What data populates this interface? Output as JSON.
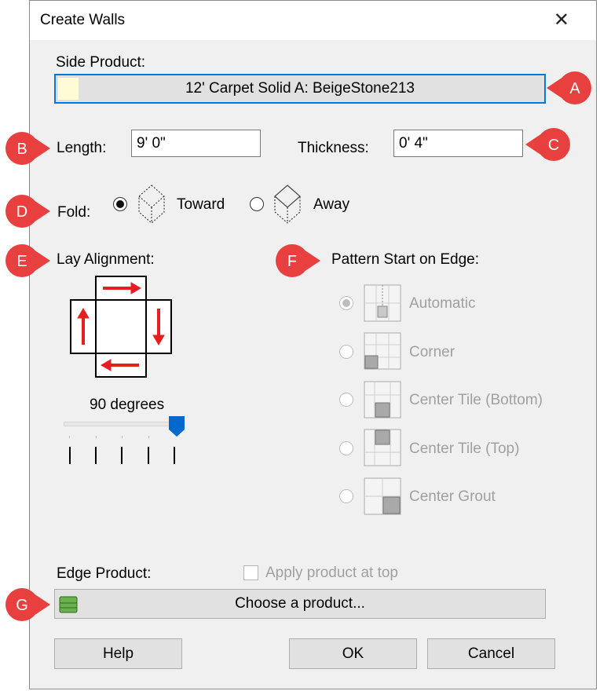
{
  "dialog": {
    "title": "Create Walls",
    "close_glyph": "✕"
  },
  "side_product": {
    "label": "Side Product:",
    "value": "12' Carpet Solid A: BeigeStone213",
    "swatch_color": "#fffbd5"
  },
  "length": {
    "label": "Length:",
    "value": "9' 0\""
  },
  "thickness": {
    "label": "Thickness:",
    "value": "0' 4\""
  },
  "fold": {
    "label": "Fold:",
    "options": [
      {
        "label": "Toward",
        "selected": true,
        "icon": "fold-toward-icon"
      },
      {
        "label": "Away",
        "selected": false,
        "icon": "fold-away-icon"
      }
    ]
  },
  "lay_alignment": {
    "label": "Lay Alignment:",
    "degrees_text": "90 degrees",
    "slider_position_fraction": 1.0,
    "tick_count": 5
  },
  "pattern_start": {
    "label": "Pattern Start on Edge:",
    "disabled": true,
    "options": [
      {
        "label": "Automatic",
        "selected": true,
        "icon": "pattern-automatic-icon"
      },
      {
        "label": "Corner",
        "selected": false,
        "icon": "pattern-corner-icon"
      },
      {
        "label": "Center Tile (Bottom)",
        "selected": false,
        "icon": "pattern-center-bottom-icon"
      },
      {
        "label": "Center Tile (Top)",
        "selected": false,
        "icon": "pattern-center-top-icon"
      },
      {
        "label": "Center Grout",
        "selected": false,
        "icon": "pattern-center-grout-icon"
      }
    ]
  },
  "edge_product": {
    "label": "Edge Product:",
    "apply_top_label": "Apply product at top",
    "apply_top_checked": false,
    "choose_label": "Choose a product...",
    "icon": "product-stack-icon"
  },
  "buttons": {
    "help": "Help",
    "ok": "OK",
    "cancel": "Cancel"
  },
  "markers": {
    "a": "A",
    "b": "B",
    "c": "C",
    "d": "D",
    "e": "E",
    "f": "F",
    "g": "G",
    "color": "#e8403f"
  }
}
